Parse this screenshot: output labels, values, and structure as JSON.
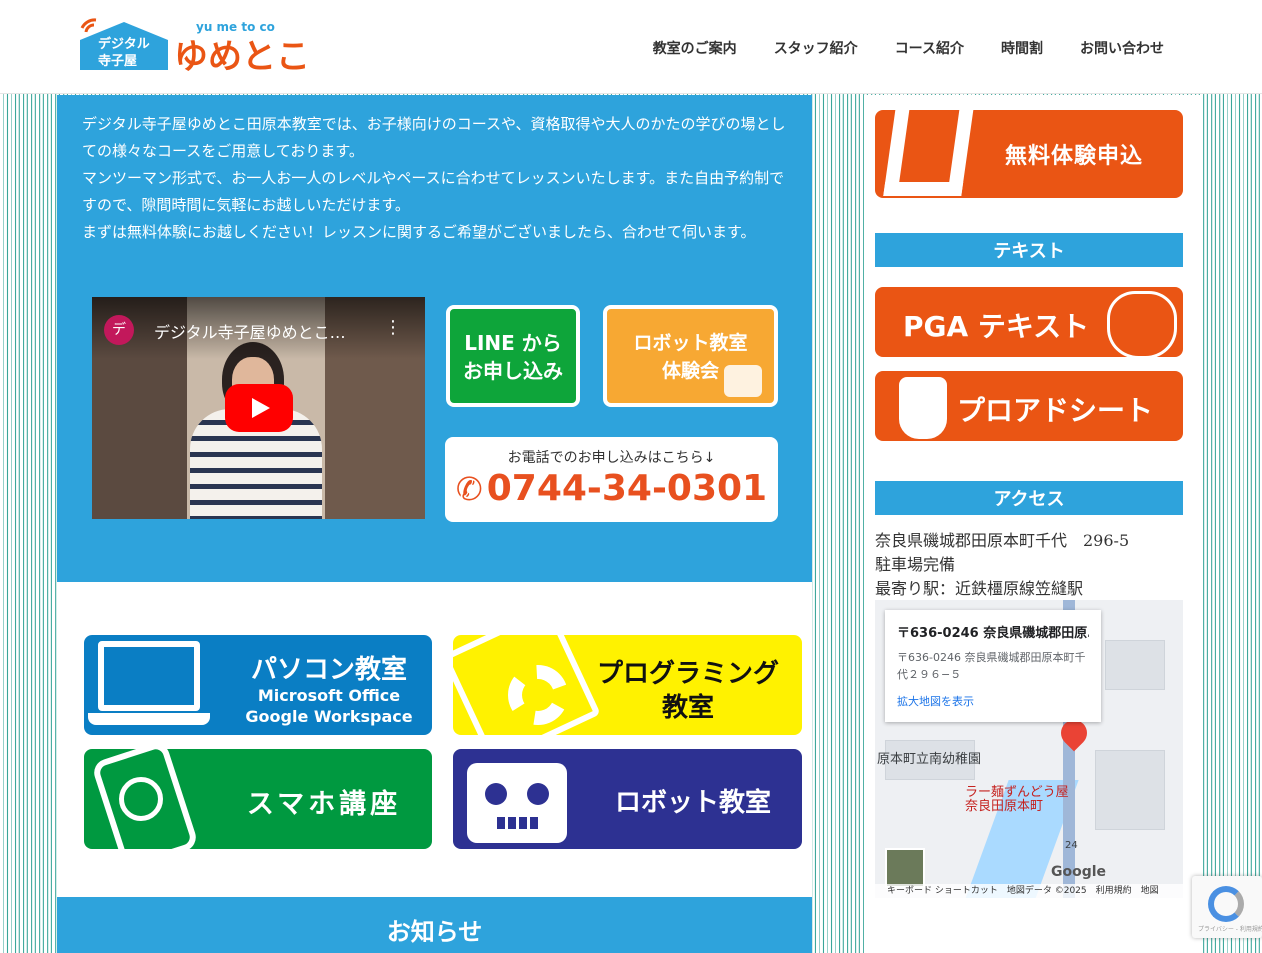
{
  "header": {
    "logo_alt": "デジタル寺子屋 ゆめとこ",
    "logo_small": "yu me to co",
    "logo_tag1": "デジタル",
    "logo_tag2": "寺子屋",
    "logo_main": "ゆめとこ",
    "nav": [
      "教室のご案内",
      "スタッフ紹介",
      "コース紹介",
      "時間割",
      "お問い合わせ"
    ]
  },
  "intro": {
    "paragraphs": [
      "デジタル寺子屋ゆめとこ田原本教室では、お子様向けのコースや、資格取得や大人のかたの学びの場としての様々なコースをご用意しております。",
      "マンツーマン形式で、お一人お一人のレベルやペースに合わせてレッスンいたします。また自由予約制ですので、隙間時間に気軽にお越しいただけます。",
      "まずは無料体験にお越しください！レッスンに関するご希望がございましたら、合わせて伺います。"
    ]
  },
  "video": {
    "channel_initial": "デ",
    "title": "デジタル寺子屋ゆめとこ…",
    "more": "⋮"
  },
  "buttons": {
    "line_1": "LINE から",
    "line_2": "お申し込み",
    "robot_1": "ロボット教室",
    "robot_2": "体験会",
    "phone_lead": "お電話でのお申し込みはこちら↓",
    "phone_icon": "✆",
    "phone_number": "0744-34-0301"
  },
  "courses": {
    "pc_title": "パソコン教室",
    "pc_sub1": "Microsoft Office",
    "pc_sub2": "Google Workspace",
    "prog_1": "プログラミング",
    "prog_2": "教室",
    "smart": "スマホ講座",
    "robot": "ロボット教室"
  },
  "news": {
    "title": "お知らせ"
  },
  "sidebar": {
    "trial_label": "無料体験申込",
    "text_heading": "テキスト",
    "pga_label": "PGA テキスト",
    "proa_label": "プロアドシート",
    "access_heading": "アクセス",
    "address": "奈良県磯城郡田原本町千代　296-5",
    "parking": "駐車場完備",
    "station": "最寄り駅：近鉄橿原線笠縫駅"
  },
  "map": {
    "card_title": "〒636-0246 奈良県磯城郡田原…",
    "card_addr": "〒636-0246 奈良県磯城郡田原本町千代２９６−５",
    "card_link": "拡大地図を表示",
    "label_kindergarten": "原本町立南幼稚園",
    "label_ramen": "ラー麺ずんどう屋 奈良田原本町",
    "route_no": "24",
    "google": "Google",
    "footer": "キーボード ショートカット　地図データ ©2025　利用規約　地図"
  },
  "recaptcha": {
    "text": "プライバシー - 利用規約"
  }
}
